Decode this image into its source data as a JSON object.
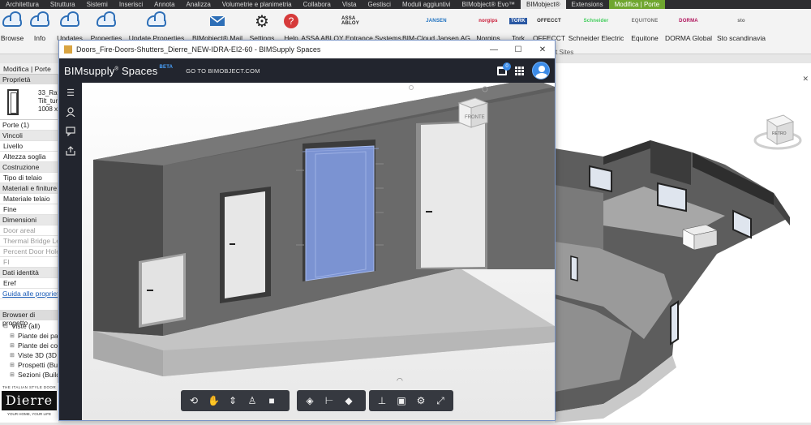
{
  "ribbon_tabs": [
    "Architettura",
    "Struttura",
    "Sistemi",
    "Inserisci",
    "Annota",
    "Analizza",
    "Volumetrie e planimetria",
    "Collabora",
    "Vista",
    "Gestisci",
    "Moduli aggiuntivi",
    "BIMobject® Evo™",
    "BIMobject®",
    "Extensions",
    "Modifica | Porte"
  ],
  "ribbon_buttons": [
    {
      "label": "Browse",
      "icon": "cloud-icon"
    },
    {
      "label": "Info",
      "icon": "cloud-icon"
    },
    {
      "label": "Updates",
      "icon": "cloud-icon"
    },
    {
      "label": "Properties",
      "icon": "cloud-icon"
    },
    {
      "label": "Update Properties",
      "icon": "cloud-icon"
    },
    {
      "label": "BIMobject® Mail",
      "icon": "mail-icon"
    },
    {
      "label": "Settings",
      "icon": "gear-icon"
    },
    {
      "label": "Help",
      "icon": "help-icon"
    },
    {
      "label": "ASSA ABLOY Entrance Systems",
      "logo": "ASSA ABLOY"
    },
    {
      "label": "BIM-Cloud Jansen AG",
      "logo": "JANSEN"
    },
    {
      "label": "Norgips",
      "logo": "norgips"
    },
    {
      "label": "Tork",
      "logo": "TORK"
    },
    {
      "label": "OFFECCT",
      "logo": "OFFECCT"
    },
    {
      "label": "Schneider Electric",
      "logo": "Schneider"
    },
    {
      "label": "Equitone",
      "logo": "EQUITONE"
    },
    {
      "label": "DORMA Global",
      "logo": "DORMA"
    },
    {
      "label": "Sto scandinavia",
      "logo": "sto"
    }
  ],
  "ribbon_group_label": "t Sites",
  "context_label": "Modifica | Porte",
  "properties": {
    "title": "Proprietà",
    "type_name": [
      "33_Rat",
      "Tilt_tur",
      "1008 x"
    ],
    "instance_count": "Porte (1)",
    "rows": [
      {
        "text": "Vincoli",
        "kind": "group"
      },
      {
        "text": "Livello",
        "kind": "item"
      },
      {
        "text": "Altezza soglia",
        "kind": "item"
      },
      {
        "text": "Costruzione",
        "kind": "group"
      },
      {
        "text": "Tipo di telaio",
        "kind": "item"
      },
      {
        "text": "Materiali e finiture",
        "kind": "group"
      },
      {
        "text": "Materiale telaio",
        "kind": "item"
      },
      {
        "text": "Fine",
        "kind": "item"
      },
      {
        "text": "Dimensioni",
        "kind": "group"
      },
      {
        "text": "Door areal",
        "kind": "dim"
      },
      {
        "text": "Thermal Bridge Len",
        "kind": "dim"
      },
      {
        "text": "Percent Door Hole",
        "kind": "dim"
      },
      {
        "text": "FI",
        "kind": "dim"
      },
      {
        "text": "Dati identità",
        "kind": "group"
      },
      {
        "text": "Eref",
        "kind": "item"
      },
      {
        "text": "Guida alle proprietà",
        "kind": "link"
      }
    ]
  },
  "project_browser": {
    "title": "Browser di progetto -",
    "root": "Viste (all)",
    "items": [
      "Piante dei pa",
      "Piante dei co",
      "Viste 3D (3D",
      "Prospetti (Buil",
      "Sezioni (Build"
    ]
  },
  "logo": {
    "tagline": "THE ITALIAN STYLE DOOR",
    "name": "Dierre",
    "sub": "YOUR HOME, YOUR LIFE"
  },
  "window": {
    "title": "Doors_Fire-Doors-Shutters_Dierre_NEW-IDRA-EI2-60 - BIMSupply Spaces",
    "controls": [
      "—",
      "☐",
      "✕"
    ]
  },
  "app": {
    "brand": "BIMsupply",
    "brand_mark": "®",
    "brand_suffix": "Spaces",
    "beta": "BETA",
    "goto": "GO TO BIMOBJECT.COM",
    "notification_count": "0"
  },
  "viewcube": {
    "face": "FRONTE"
  },
  "revit_viewcube": {
    "face": "RETRO"
  },
  "side_nav": [
    "menu-icon",
    "user-icon",
    "chat-icon",
    "export-icon"
  ],
  "toolbar_groups": [
    [
      "orbit-icon",
      "pan-icon",
      "updown-icon",
      "walk-icon",
      "camera-icon"
    ],
    [
      "add-object-icon",
      "measure-icon",
      "cube-icon"
    ],
    [
      "hierarchy-icon",
      "save-icon",
      "settings-icon",
      "expand-icon"
    ]
  ],
  "colors": {
    "selected_door": "#7b93d2",
    "app_header": "#22252e",
    "accent": "#3b8be8",
    "contextual_tab": "#6fa62f"
  }
}
